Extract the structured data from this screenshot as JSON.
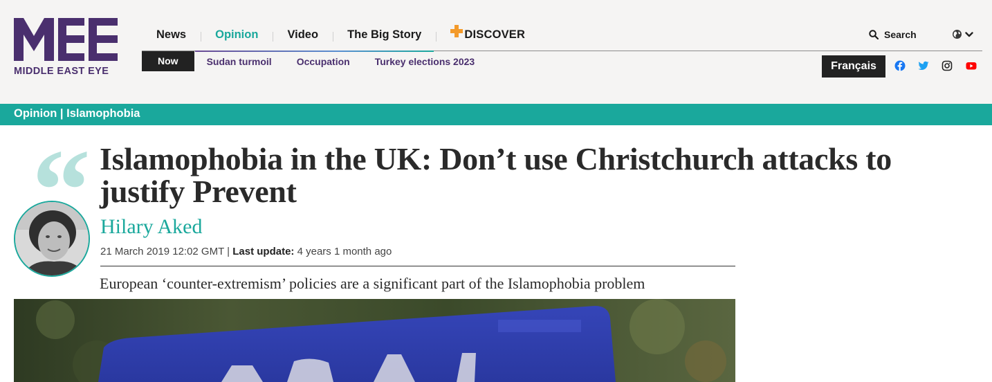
{
  "brand": {
    "name": "MIDDLE EAST EYE",
    "color": "#4a2f6e"
  },
  "main_nav": [
    {
      "label": "News",
      "active": false
    },
    {
      "label": "Opinion",
      "active": true
    },
    {
      "label": "Video",
      "active": false
    },
    {
      "label": "The Big Story",
      "active": false
    }
  ],
  "discover": {
    "label": "DISCOVER",
    "icon": "plus-icon"
  },
  "sub_nav": {
    "now_label": "Now",
    "items": [
      "Sudan turmoil",
      "Occupation",
      "Turkey elections 2023"
    ]
  },
  "search": {
    "label": "Search",
    "icon": "search-icon"
  },
  "language": {
    "icon": "globe-icon",
    "francais_label": "Français"
  },
  "social": [
    {
      "name": "facebook-icon",
      "color": "#1877f2"
    },
    {
      "name": "twitter-icon",
      "color": "#1da1f2"
    },
    {
      "name": "instagram-icon",
      "color": "#222222"
    },
    {
      "name": "youtube-icon",
      "color": "#ff0000"
    }
  ],
  "section": {
    "primary": "Opinion",
    "separator": " | ",
    "secondary": "Islamophobia",
    "color": "#1aa89c"
  },
  "article": {
    "headline": "Islamophobia in the UK: Don’t use Christchurch attacks to justify Prevent",
    "author": "Hilary Aked",
    "date": "21 March 2019 12:02 GMT",
    "date_separator": " | ",
    "last_update_label": "Last update:",
    "last_update_value": " 4 years 1 month ago",
    "standfirst": "European ‘counter-extremism’ policies are a significant part of the Islamophobia problem",
    "quote_mark": "“"
  },
  "colors": {
    "accent": "#1aa89c",
    "header_bg": "#f5f4f3",
    "quote": "#b6e1dc"
  }
}
